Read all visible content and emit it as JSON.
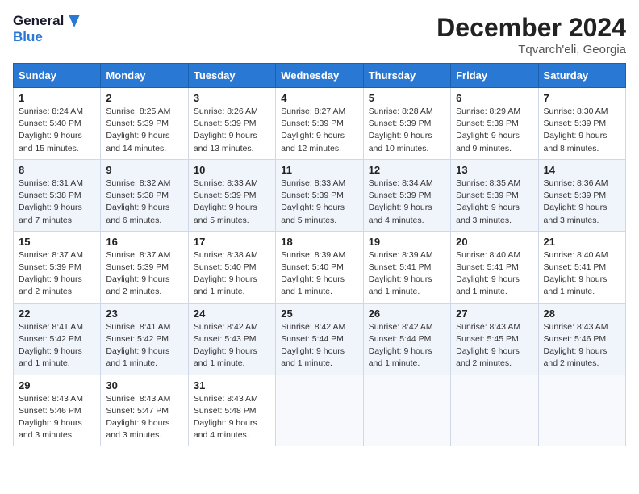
{
  "header": {
    "logo_line1": "General",
    "logo_line2": "Blue",
    "month": "December 2024",
    "location": "Tqvarch'eli, Georgia"
  },
  "weekdays": [
    "Sunday",
    "Monday",
    "Tuesday",
    "Wednesday",
    "Thursday",
    "Friday",
    "Saturday"
  ],
  "weeks": [
    [
      {
        "day": "1",
        "info": "Sunrise: 8:24 AM\nSunset: 5:40 PM\nDaylight: 9 hours\nand 15 minutes."
      },
      {
        "day": "2",
        "info": "Sunrise: 8:25 AM\nSunset: 5:39 PM\nDaylight: 9 hours\nand 14 minutes."
      },
      {
        "day": "3",
        "info": "Sunrise: 8:26 AM\nSunset: 5:39 PM\nDaylight: 9 hours\nand 13 minutes."
      },
      {
        "day": "4",
        "info": "Sunrise: 8:27 AM\nSunset: 5:39 PM\nDaylight: 9 hours\nand 12 minutes."
      },
      {
        "day": "5",
        "info": "Sunrise: 8:28 AM\nSunset: 5:39 PM\nDaylight: 9 hours\nand 10 minutes."
      },
      {
        "day": "6",
        "info": "Sunrise: 8:29 AM\nSunset: 5:39 PM\nDaylight: 9 hours\nand 9 minutes."
      },
      {
        "day": "7",
        "info": "Sunrise: 8:30 AM\nSunset: 5:39 PM\nDaylight: 9 hours\nand 8 minutes."
      }
    ],
    [
      {
        "day": "8",
        "info": "Sunrise: 8:31 AM\nSunset: 5:38 PM\nDaylight: 9 hours\nand 7 minutes."
      },
      {
        "day": "9",
        "info": "Sunrise: 8:32 AM\nSunset: 5:38 PM\nDaylight: 9 hours\nand 6 minutes."
      },
      {
        "day": "10",
        "info": "Sunrise: 8:33 AM\nSunset: 5:39 PM\nDaylight: 9 hours\nand 5 minutes."
      },
      {
        "day": "11",
        "info": "Sunrise: 8:33 AM\nSunset: 5:39 PM\nDaylight: 9 hours\nand 5 minutes."
      },
      {
        "day": "12",
        "info": "Sunrise: 8:34 AM\nSunset: 5:39 PM\nDaylight: 9 hours\nand 4 minutes."
      },
      {
        "day": "13",
        "info": "Sunrise: 8:35 AM\nSunset: 5:39 PM\nDaylight: 9 hours\nand 3 minutes."
      },
      {
        "day": "14",
        "info": "Sunrise: 8:36 AM\nSunset: 5:39 PM\nDaylight: 9 hours\nand 3 minutes."
      }
    ],
    [
      {
        "day": "15",
        "info": "Sunrise: 8:37 AM\nSunset: 5:39 PM\nDaylight: 9 hours\nand 2 minutes."
      },
      {
        "day": "16",
        "info": "Sunrise: 8:37 AM\nSunset: 5:39 PM\nDaylight: 9 hours\nand 2 minutes."
      },
      {
        "day": "17",
        "info": "Sunrise: 8:38 AM\nSunset: 5:40 PM\nDaylight: 9 hours\nand 1 minute."
      },
      {
        "day": "18",
        "info": "Sunrise: 8:39 AM\nSunset: 5:40 PM\nDaylight: 9 hours\nand 1 minute."
      },
      {
        "day": "19",
        "info": "Sunrise: 8:39 AM\nSunset: 5:41 PM\nDaylight: 9 hours\nand 1 minute."
      },
      {
        "day": "20",
        "info": "Sunrise: 8:40 AM\nSunset: 5:41 PM\nDaylight: 9 hours\nand 1 minute."
      },
      {
        "day": "21",
        "info": "Sunrise: 8:40 AM\nSunset: 5:41 PM\nDaylight: 9 hours\nand 1 minute."
      }
    ],
    [
      {
        "day": "22",
        "info": "Sunrise: 8:41 AM\nSunset: 5:42 PM\nDaylight: 9 hours\nand 1 minute."
      },
      {
        "day": "23",
        "info": "Sunrise: 8:41 AM\nSunset: 5:42 PM\nDaylight: 9 hours\nand 1 minute."
      },
      {
        "day": "24",
        "info": "Sunrise: 8:42 AM\nSunset: 5:43 PM\nDaylight: 9 hours\nand 1 minute."
      },
      {
        "day": "25",
        "info": "Sunrise: 8:42 AM\nSunset: 5:44 PM\nDaylight: 9 hours\nand 1 minute."
      },
      {
        "day": "26",
        "info": "Sunrise: 8:42 AM\nSunset: 5:44 PM\nDaylight: 9 hours\nand 1 minute."
      },
      {
        "day": "27",
        "info": "Sunrise: 8:43 AM\nSunset: 5:45 PM\nDaylight: 9 hours\nand 2 minutes."
      },
      {
        "day": "28",
        "info": "Sunrise: 8:43 AM\nSunset: 5:46 PM\nDaylight: 9 hours\nand 2 minutes."
      }
    ],
    [
      {
        "day": "29",
        "info": "Sunrise: 8:43 AM\nSunset: 5:46 PM\nDaylight: 9 hours\nand 3 minutes."
      },
      {
        "day": "30",
        "info": "Sunrise: 8:43 AM\nSunset: 5:47 PM\nDaylight: 9 hours\nand 3 minutes."
      },
      {
        "day": "31",
        "info": "Sunrise: 8:43 AM\nSunset: 5:48 PM\nDaylight: 9 hours\nand 4 minutes."
      },
      {
        "day": "",
        "info": ""
      },
      {
        "day": "",
        "info": ""
      },
      {
        "day": "",
        "info": ""
      },
      {
        "day": "",
        "info": ""
      }
    ]
  ]
}
